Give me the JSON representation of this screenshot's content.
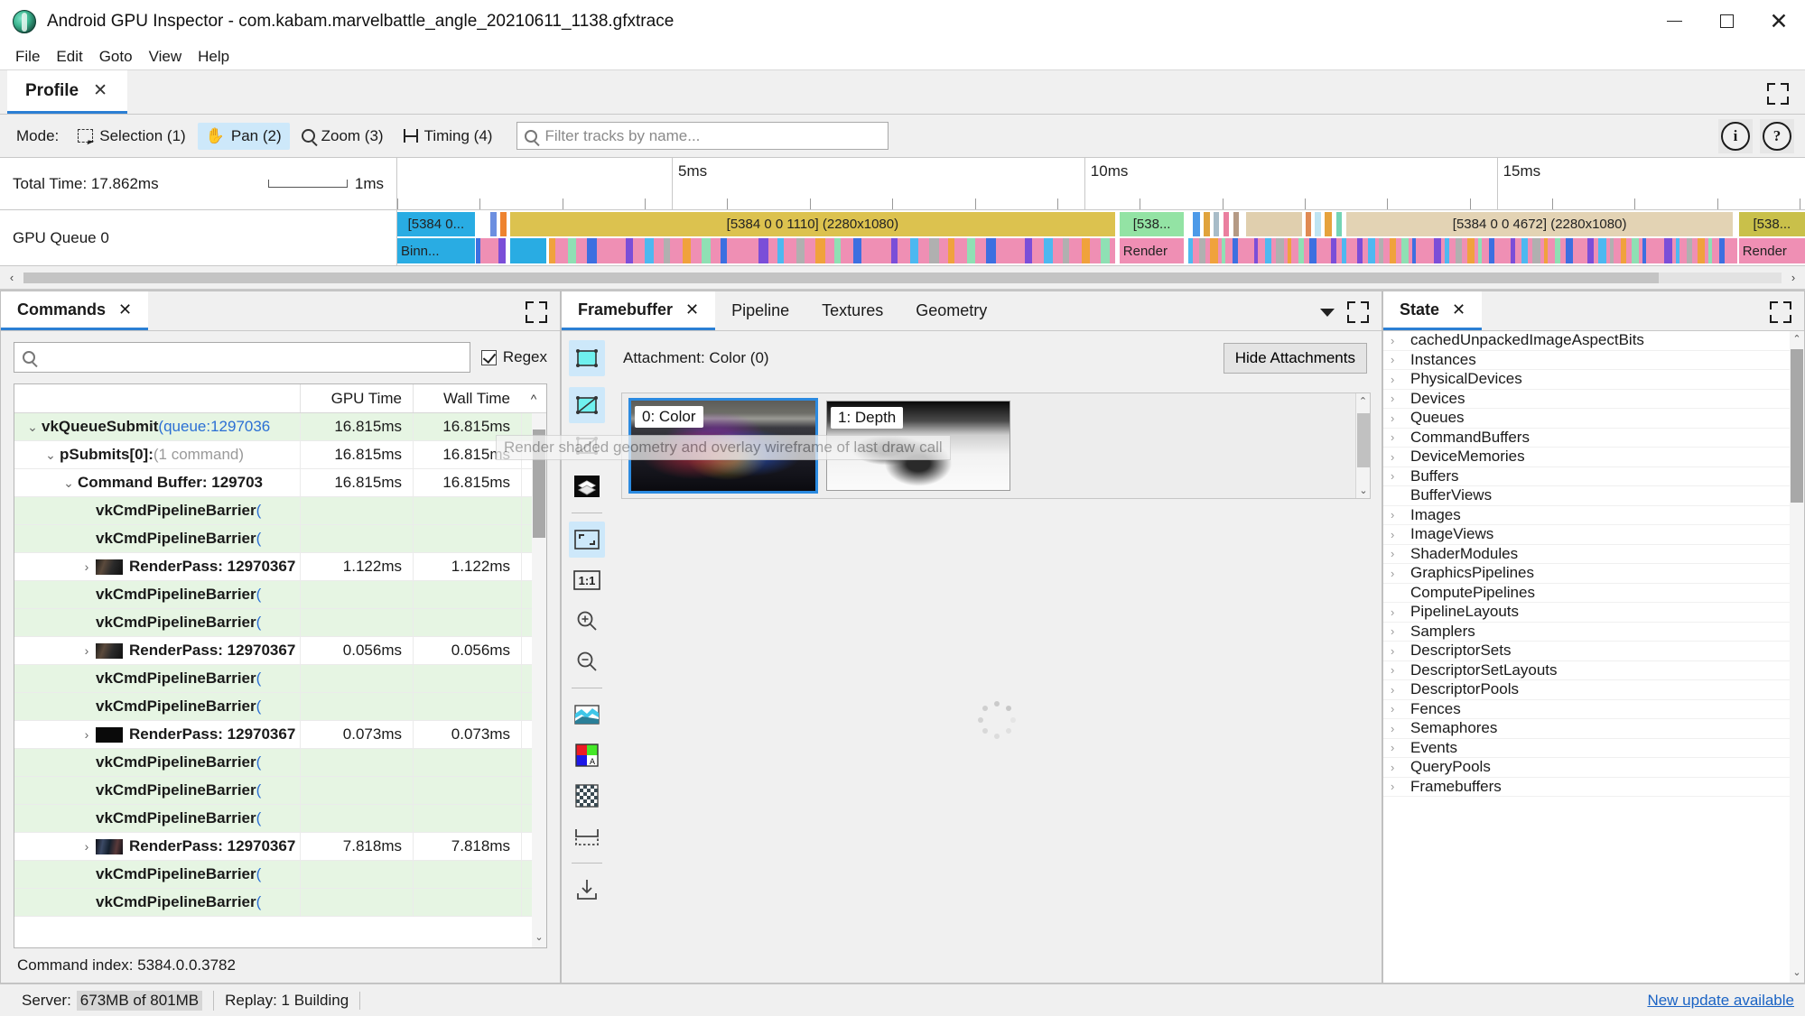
{
  "window": {
    "title": "Android GPU Inspector - com.kabam.marvelbattle_angle_20210611_1138.gfxtrace",
    "icon": "app-logo-icon",
    "minimize": "–",
    "maximize": "□",
    "close": "✕"
  },
  "menubar": {
    "items": [
      "File",
      "Edit",
      "Goto",
      "View",
      "Help"
    ]
  },
  "profile_tab": {
    "label": "Profile",
    "close": "✕"
  },
  "modebar": {
    "label": "Mode:",
    "modes": [
      {
        "label": "Selection (1)",
        "icon": "selection-icon",
        "active": false
      },
      {
        "label": "Pan (2)",
        "icon": "hand-icon",
        "active": true
      },
      {
        "label": "Zoom (3)",
        "icon": "magnifier-icon",
        "active": false
      },
      {
        "label": "Timing (4)",
        "icon": "timing-icon",
        "active": false
      }
    ],
    "filter_placeholder": "Filter tracks by name...",
    "filter_value": "",
    "info_icon": "i",
    "help_icon": "?"
  },
  "timeline": {
    "total_time_label": "Total Time: 17.862ms",
    "scale_label": "1ms",
    "track_name": "GPU Queue 0",
    "ticks": [
      {
        "label": "5ms",
        "left_pct": 19.5
      },
      {
        "label": "10ms",
        "left_pct": 48.8
      },
      {
        "label": "15ms",
        "left_pct": 78.1
      }
    ],
    "blocks_top": [
      {
        "label": "[5384 0...",
        "left_pct": 0.0,
        "width_pct": 5.5,
        "color": "#29ace3"
      },
      {
        "label": "",
        "left_pct": 6.6,
        "width_pct": 0.45,
        "color": "#6c8fe0"
      },
      {
        "label": "",
        "left_pct": 7.3,
        "width_pct": 0.45,
        "color": "#ee8330"
      },
      {
        "label": "[5384 0 0 1110] (2280x1080)",
        "left_pct": 8.0,
        "width_pct": 43.0,
        "color": "#dcc24f"
      },
      {
        "label": "[538...",
        "left_pct": 51.3,
        "width_pct": 4.6,
        "color": "#93e3a4"
      },
      {
        "label": "",
        "left_pct": 56.5,
        "width_pct": 0.5,
        "color": "#4d9ae8"
      },
      {
        "label": "",
        "left_pct": 57.3,
        "width_pct": 0.4,
        "color": "#e0a33c"
      },
      {
        "label": "",
        "left_pct": 58.0,
        "width_pct": 0.4,
        "color": "#a8bcc8"
      },
      {
        "label": "",
        "left_pct": 58.7,
        "width_pct": 0.4,
        "color": "#ea7f9f"
      },
      {
        "label": "",
        "left_pct": 59.4,
        "width_pct": 0.4,
        "color": "#b59a85"
      },
      {
        "label": "",
        "left_pct": 60.3,
        "width_pct": 4.0,
        "color": "#e0cfae"
      },
      {
        "label": "",
        "left_pct": 64.5,
        "width_pct": 0.4,
        "color": "#e08a52"
      },
      {
        "label": "",
        "left_pct": 65.2,
        "width_pct": 0.4,
        "color": "#bfe4f2"
      },
      {
        "label": "",
        "left_pct": 65.9,
        "width_pct": 0.5,
        "color": "#e6a23c"
      },
      {
        "label": "",
        "left_pct": 66.7,
        "width_pct": 0.4,
        "color": "#74d4b4"
      },
      {
        "label": "[5384 0 0 4672] (2280x1080)",
        "left_pct": 67.4,
        "width_pct": 27.5,
        "color": "#e3d3b4"
      },
      {
        "label": "[538...",
        "left_pct": 95.3,
        "width_pct": 4.7,
        "color": "#c9c04a"
      }
    ],
    "blocks_bottom": [
      {
        "label": "Binn...",
        "left_pct": 0.0,
        "width_pct": 5.5,
        "color": "#29ace3"
      },
      {
        "label": "",
        "left_pct": 5.6,
        "width_pct": 1.9,
        "color": "#ef8fb4"
      },
      {
        "label": "",
        "left_pct": 8.0,
        "width_pct": 2.6,
        "color": "#29ace3"
      },
      {
        "label": "",
        "left_pct": 10.8,
        "width_pct": 40.2,
        "color": "#ef8fb4"
      },
      {
        "label": "Render",
        "left_pct": 51.3,
        "width_pct": 4.6,
        "color": "#ef8fb4"
      },
      {
        "label": "",
        "left_pct": 56.2,
        "width_pct": 11.0,
        "color": "#ef8fb4"
      },
      {
        "label": "",
        "left_pct": 67.4,
        "width_pct": 27.5,
        "color": "#ef8fb4"
      },
      {
        "label": "Render",
        "left_pct": 95.3,
        "width_pct": 4.7,
        "color": "#ef8fb4"
      }
    ]
  },
  "commands_panel": {
    "tab_label": "Commands",
    "tab_close": "✕",
    "search_placeholder": "",
    "search_value": "",
    "regex_label": "Regex",
    "regex_checked": true,
    "columns": {
      "name": "",
      "gpu": "GPU Time",
      "wall": "Wall Time",
      "sort": "^"
    },
    "rows": [
      {
        "indent": 0,
        "twisty": "v",
        "name": "vkQueueSubmit",
        "suffix": "(queue:1297036",
        "suffix_style": "link",
        "gpu": "16.815ms",
        "wall": "16.815ms",
        "bg": "green",
        "thumb": ""
      },
      {
        "indent": 1,
        "twisty": "v",
        "name": "pSubmits[0]:",
        "suffix": "(1 command)",
        "suffix_style": "muted",
        "gpu": "16.815ms",
        "wall": "16.815ms",
        "bg": "white",
        "thumb": ""
      },
      {
        "indent": 2,
        "twisty": "v",
        "name": "Command Buffer: 129703",
        "suffix": "",
        "suffix_style": "",
        "gpu": "16.815ms",
        "wall": "16.815ms",
        "bg": "white",
        "thumb": ""
      },
      {
        "indent": 3,
        "twisty": "",
        "name": "vkCmdPipelineBarrier",
        "suffix": "(",
        "suffix_style": "link",
        "gpu": "",
        "wall": "",
        "bg": "green",
        "thumb": ""
      },
      {
        "indent": 3,
        "twisty": "",
        "name": "vkCmdPipelineBarrier",
        "suffix": "(",
        "suffix_style": "link",
        "gpu": "",
        "wall": "",
        "bg": "green",
        "thumb": ""
      },
      {
        "indent": 3,
        "twisty": ">",
        "name": "RenderPass: 12970367",
        "suffix": "",
        "suffix_style": "",
        "gpu": "1.122ms",
        "wall": "1.122ms",
        "bg": "white",
        "thumb": "a"
      },
      {
        "indent": 3,
        "twisty": "",
        "name": "vkCmdPipelineBarrier",
        "suffix": "(",
        "suffix_style": "link",
        "gpu": "",
        "wall": "",
        "bg": "green",
        "thumb": ""
      },
      {
        "indent": 3,
        "twisty": "",
        "name": "vkCmdPipelineBarrier",
        "suffix": "(",
        "suffix_style": "link",
        "gpu": "",
        "wall": "",
        "bg": "green",
        "thumb": ""
      },
      {
        "indent": 3,
        "twisty": ">",
        "name": "RenderPass: 12970367",
        "suffix": "",
        "suffix_style": "",
        "gpu": "0.056ms",
        "wall": "0.056ms",
        "bg": "white",
        "thumb": "a"
      },
      {
        "indent": 3,
        "twisty": "",
        "name": "vkCmdPipelineBarrier",
        "suffix": "(",
        "suffix_style": "link",
        "gpu": "",
        "wall": "",
        "bg": "green",
        "thumb": ""
      },
      {
        "indent": 3,
        "twisty": "",
        "name": "vkCmdPipelineBarrier",
        "suffix": "(",
        "suffix_style": "link",
        "gpu": "",
        "wall": "",
        "bg": "green",
        "thumb": ""
      },
      {
        "indent": 3,
        "twisty": ">",
        "name": "RenderPass: 12970367",
        "suffix": "",
        "suffix_style": "",
        "gpu": "0.073ms",
        "wall": "0.073ms",
        "bg": "white",
        "thumb": "b"
      },
      {
        "indent": 3,
        "twisty": "",
        "name": "vkCmdPipelineBarrier",
        "suffix": "(",
        "suffix_style": "link",
        "gpu": "",
        "wall": "",
        "bg": "green",
        "thumb": ""
      },
      {
        "indent": 3,
        "twisty": "",
        "name": "vkCmdPipelineBarrier",
        "suffix": "(",
        "suffix_style": "link",
        "gpu": "",
        "wall": "",
        "bg": "green",
        "thumb": ""
      },
      {
        "indent": 3,
        "twisty": "",
        "name": "vkCmdPipelineBarrier",
        "suffix": "(",
        "suffix_style": "link",
        "gpu": "",
        "wall": "",
        "bg": "green",
        "thumb": ""
      },
      {
        "indent": 3,
        "twisty": ">",
        "name": "RenderPass: 12970367",
        "suffix": "",
        "suffix_style": "",
        "gpu": "7.818ms",
        "wall": "7.818ms",
        "bg": "white",
        "thumb": "c"
      },
      {
        "indent": 3,
        "twisty": "",
        "name": "vkCmdPipelineBarrier",
        "suffix": "(",
        "suffix_style": "link",
        "gpu": "",
        "wall": "",
        "bg": "green",
        "thumb": ""
      },
      {
        "indent": 3,
        "twisty": "",
        "name": "vkCmdPipelineBarrier",
        "suffix": "(",
        "suffix_style": "link",
        "gpu": "",
        "wall": "",
        "bg": "green",
        "thumb": ""
      }
    ],
    "status": "Command index: 5384.0.0.3782"
  },
  "framebuffer_panel": {
    "tabs": [
      {
        "label": "Framebuffer",
        "active": true,
        "close": "✕"
      },
      {
        "label": "Pipeline",
        "active": false
      },
      {
        "label": "Textures",
        "active": false
      },
      {
        "label": "Geometry",
        "active": false
      }
    ],
    "attachment_label": "Attachment: Color (0)",
    "hide_attachments_button": "Hide Attachments",
    "tooltip": "Render shaded geometry and overlay wireframe of last draw call",
    "tools": [
      {
        "name": "shaded-geometry-icon",
        "active": true
      },
      {
        "name": "shaded-wireframe-icon",
        "active": true
      },
      {
        "name": "wireframe-icon",
        "active": false
      },
      {
        "name": "overdraw-icon",
        "active": false
      },
      {
        "divider": true
      },
      {
        "name": "fit-to-window-icon",
        "active": true
      },
      {
        "name": "actual-size-icon",
        "active": false
      },
      {
        "name": "zoom-in-icon",
        "active": false
      },
      {
        "name": "zoom-out-icon",
        "active": false
      },
      {
        "divider": true
      },
      {
        "name": "histogram-icon",
        "active": false
      },
      {
        "name": "color-channels-icon",
        "active": false
      },
      {
        "name": "checkerboard-background-icon",
        "active": false
      },
      {
        "name": "flip-vertically-icon",
        "active": false
      },
      {
        "divider": true
      },
      {
        "name": "save-image-icon",
        "active": false
      }
    ],
    "attachments": [
      {
        "label": "0: Color",
        "selected": true
      },
      {
        "label": "1: Depth",
        "selected": false
      }
    ]
  },
  "state_panel": {
    "tab_label": "State",
    "tab_close": "✕",
    "items": [
      {
        "label": "cachedUnpackedImageAspectBits",
        "expandable": true
      },
      {
        "label": "Instances",
        "expandable": true
      },
      {
        "label": "PhysicalDevices",
        "expandable": true
      },
      {
        "label": "Devices",
        "expandable": true
      },
      {
        "label": "Queues",
        "expandable": true
      },
      {
        "label": "CommandBuffers",
        "expandable": true
      },
      {
        "label": "DeviceMemories",
        "expandable": true
      },
      {
        "label": "Buffers",
        "expandable": true
      },
      {
        "label": "BufferViews",
        "expandable": false
      },
      {
        "label": "Images",
        "expandable": true
      },
      {
        "label": "ImageViews",
        "expandable": true
      },
      {
        "label": "ShaderModules",
        "expandable": true
      },
      {
        "label": "GraphicsPipelines",
        "expandable": true
      },
      {
        "label": "ComputePipelines",
        "expandable": false
      },
      {
        "label": "PipelineLayouts",
        "expandable": true
      },
      {
        "label": "Samplers",
        "expandable": true
      },
      {
        "label": "DescriptorSets",
        "expandable": true
      },
      {
        "label": "DescriptorSetLayouts",
        "expandable": true
      },
      {
        "label": "DescriptorPools",
        "expandable": true
      },
      {
        "label": "Fences",
        "expandable": true
      },
      {
        "label": "Semaphores",
        "expandable": true
      },
      {
        "label": "Events",
        "expandable": true
      },
      {
        "label": "QueryPools",
        "expandable": true
      },
      {
        "label": "Framebuffers",
        "expandable": true
      }
    ]
  },
  "statusbar": {
    "server_label": "Server:",
    "server_value": "673MB of 801MB",
    "replay": "Replay: 1 Building",
    "update_link": "New update available"
  },
  "colors": {
    "accent": "#2b7fd4",
    "tab_active_underline": "#2b7fd4",
    "mode_active_bg": "#cde8fa",
    "row_green": "#e6f5e3",
    "link": "#1a63c4"
  }
}
